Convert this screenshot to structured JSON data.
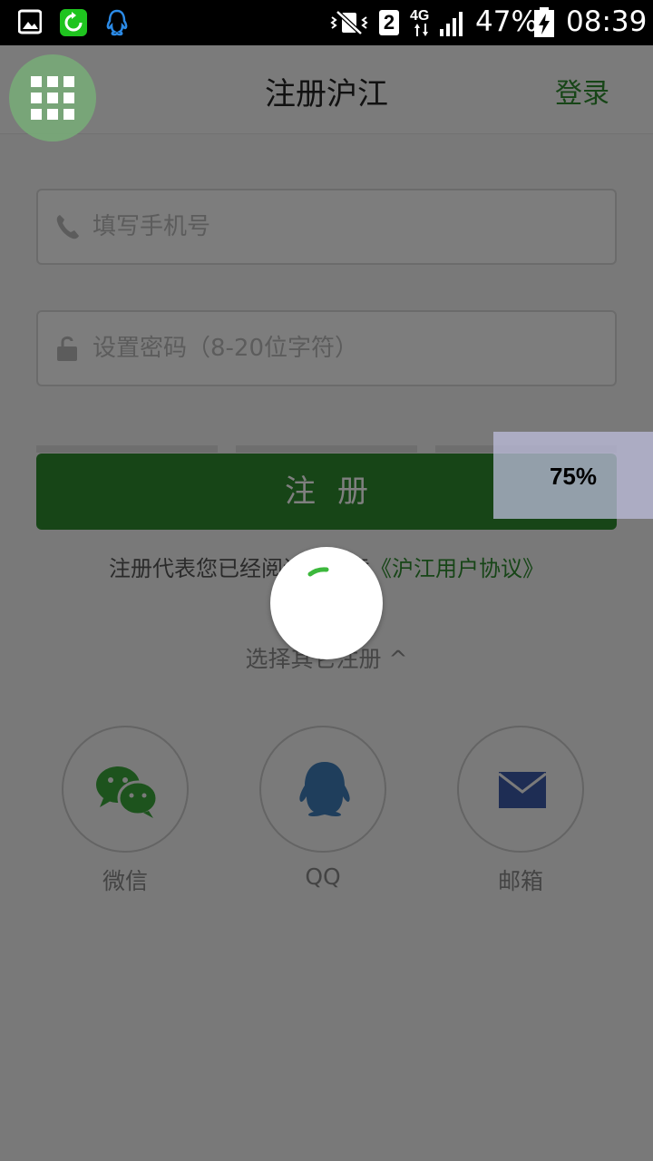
{
  "status_bar": {
    "sim_label": "2",
    "network_label": "4G",
    "battery_percent": "47%",
    "time": "08:39",
    "icons": [
      "gallery-icon",
      "sync-app-icon",
      "qq-notification-icon",
      "vibrate-icon",
      "sim-icon",
      "signal-icon",
      "battery-charging-icon"
    ]
  },
  "header": {
    "title": "注册沪江",
    "login_label": "登录"
  },
  "form": {
    "phone_placeholder": "填写手机号",
    "password_placeholder": "设置密码（8-20位字符）",
    "register_label": "注册"
  },
  "agreement": {
    "text": "注册代表您已经阅读并同意",
    "link": "《沪江用户协议》"
  },
  "other_signup": {
    "label": "选择其它注册 ^"
  },
  "social": [
    {
      "label": "微信",
      "icon": "wechat-icon"
    },
    {
      "label": "QQ",
      "icon": "qq-icon"
    },
    {
      "label": "邮箱",
      "icon": "mail-icon"
    }
  ],
  "overlay": {
    "percent": "75%",
    "progress_fraction": 0.75
  },
  "colors": {
    "brand_green": "#2e8b2e",
    "qq_blue": "#3e7cb8",
    "mail_blue": "#3c5aa8"
  }
}
